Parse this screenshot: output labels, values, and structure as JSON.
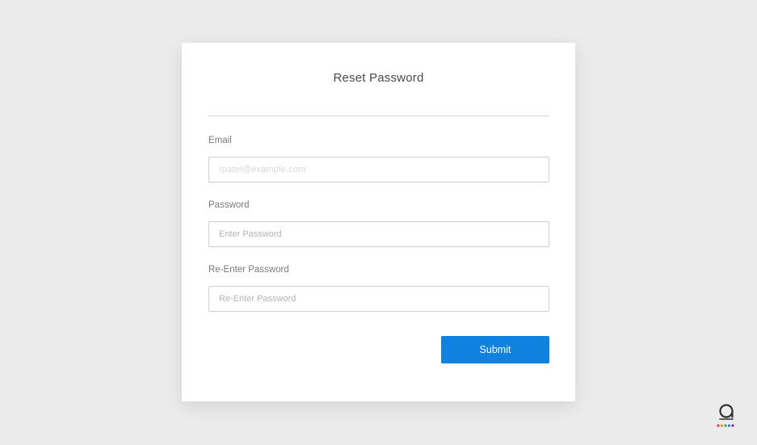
{
  "form": {
    "title": "Reset Password",
    "email": {
      "label": "Email",
      "value": "rpatel@example.com"
    },
    "password": {
      "label": "Password",
      "placeholder": "Enter Password"
    },
    "reenter": {
      "label": "Re-Enter Password",
      "placeholder": "Re-Enter Password"
    },
    "submit_label": "Submit"
  },
  "colors": {
    "background": "#ebebeb",
    "card": "#ffffff",
    "accent": "#0f82e0"
  },
  "icons": {
    "brand": "brand-logo-icon"
  }
}
